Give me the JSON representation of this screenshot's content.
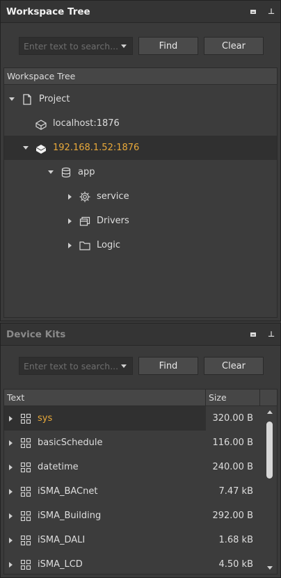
{
  "workspace": {
    "title": "Workspace Tree",
    "search_placeholder": "Enter text to search...",
    "find_label": "Find",
    "clear_label": "Clear",
    "column_header": "Workspace Tree",
    "tree": [
      {
        "label": "Project",
        "icon": "file-icon",
        "expanded": true
      },
      {
        "label": "localhost:1876",
        "icon": "device-outline-icon"
      },
      {
        "label": "192.168.1.52:1876",
        "icon": "device-solid-icon",
        "expanded": true,
        "selected": true
      },
      {
        "label": "app",
        "icon": "database-icon",
        "expanded": true
      },
      {
        "label": "service",
        "icon": "gear-icon"
      },
      {
        "label": "Drivers",
        "icon": "drivers-icon"
      },
      {
        "label": "Logic",
        "icon": "folder-icon"
      }
    ]
  },
  "device_kits": {
    "title": "Device Kits",
    "search_placeholder": "Enter text to search...",
    "find_label": "Find",
    "clear_label": "Clear",
    "columns": {
      "text": "Text",
      "size": "Size"
    },
    "rows": [
      {
        "name": "sys",
        "size": "320.00 B",
        "selected": true
      },
      {
        "name": "basicSchedule",
        "size": "116.00 B"
      },
      {
        "name": "datetime",
        "size": "240.00 B"
      },
      {
        "name": "iSMA_BACnet",
        "size": "7.47 kB"
      },
      {
        "name": "iSMA_Building",
        "size": "292.00 B"
      },
      {
        "name": "iSMA_DALI",
        "size": "1.68 kB"
      },
      {
        "name": "iSMA_LCD",
        "size": "4.50 kB"
      }
    ]
  },
  "colors": {
    "highlight": "#e8a93a",
    "panel_bg": "#3a3a3a",
    "selected_row_bg": "#303030"
  }
}
